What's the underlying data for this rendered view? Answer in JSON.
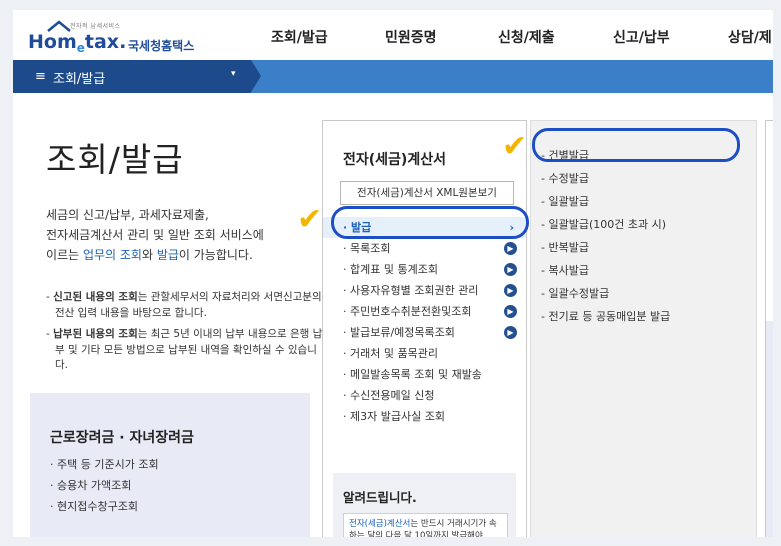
{
  "header": {
    "logo_tagline": "전자적 납세서비스",
    "logo_brand": [
      "Hom",
      "e",
      "tax",
      "."
    ],
    "logo_korean": "국세청홈택스",
    "menu": [
      "조회/발급",
      "민원증명",
      "신청/제출",
      "신고/납부",
      "상담/제"
    ]
  },
  "navbar": {
    "menu_icon": "hamburger-icon",
    "title": "조회/발급",
    "caret": "▾",
    "colors": {
      "dark": "#1d4a8b",
      "bar": "#3a7fc7"
    }
  },
  "intro": {
    "title": "조회/발급",
    "desc_line1": "세금의 신고/납부, 과세자료제출,",
    "desc_line2": "전자세금계산서 관리 및 일반 조회 서비스에",
    "desc_line3_prefix": "이르는 ",
    "desc_link1": "업무의 조회",
    "desc_mid": "와 ",
    "desc_link2": "발급",
    "desc_suffix": "이 가능합니다.",
    "notes": [
      {
        "bold": "신고된 내용의 조회",
        "text": "는 관할세무서의 자료처리와 서면신고분의 전산 입력 내용을 바탕으로 합니다."
      },
      {
        "bold": "납부된 내용의 조회",
        "text": "는 최근 5년 이내의 납부 내용으로 은행 납부 및 기타 모든 방법으로 납부된 내역을 확인하실 수 있습니다."
      }
    ]
  },
  "leftbox": {
    "title": "근로장려금 · 자녀장려금",
    "items": [
      "주택 등 기준시가 조회",
      "승용차 가액조회",
      "현지접수창구조회"
    ]
  },
  "panel": {
    "title": "전자(세금)계산서",
    "xml_button": "전자(세금)계산서 XML원본보기",
    "menu": [
      {
        "label": "발급",
        "active": true
      },
      {
        "label": "목록조회"
      },
      {
        "label": "합계표 및 통계조회"
      },
      {
        "label": "사용자유형별 조회권한 관리"
      },
      {
        "label": "주민번호수취분전환및조회"
      },
      {
        "label": "발급보류/예정목록조회"
      },
      {
        "label": "거래처 및 품목관리"
      },
      {
        "label": "메일발송목록 조회 및 재발송"
      },
      {
        "label": "수신전용메일 신청"
      },
      {
        "label": "제3자 발급사실 조회"
      }
    ],
    "notice_title": "알려드립니다.",
    "notice_text_hl": "전자(세금)계산서",
    "notice_text": "는 반드시 거래시기가 속하는 달의 다음 달 10일까지 발급해야"
  },
  "submenu": {
    "items": [
      "건별발급",
      "수정발급",
      "일괄발급",
      "일괄발급(100건 초과 시)",
      "반복발급",
      "복사발급",
      "일괄수정발급",
      "전기료 등 공동매입분 발급"
    ]
  },
  "annotations": {
    "highlight_color": "#1d4fc4",
    "check_color": "#f3b600",
    "check_mark": "✔"
  }
}
